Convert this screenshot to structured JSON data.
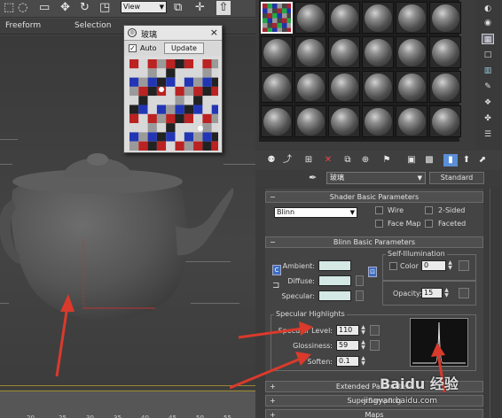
{
  "toolbar": {
    "view_dropdown": "View",
    "icons": [
      "select-region-icon",
      "move-icon",
      "rotate-icon",
      "scale-icon",
      "snap-icon",
      "render-icon"
    ]
  },
  "ribbon": {
    "tab1": "Freeform",
    "tab2": "Selection"
  },
  "viewport_ruler": {
    "ticks": [
      "20",
      "25",
      "30",
      "35",
      "40",
      "45",
      "50",
      "55",
      "60"
    ]
  },
  "preview_window": {
    "title": "玻璃",
    "close": "×",
    "auto_label": "Auto",
    "auto_checked": "✓",
    "update_label": "Update"
  },
  "material_name": "玻璃",
  "material_type": "Standard",
  "shader_basic": {
    "header": "Shader Basic Parameters",
    "shader": "Blinn",
    "wire": "Wire",
    "two_sided": "2-Sided",
    "face_map": "Face Map",
    "faceted": "Faceted"
  },
  "blinn_basic": {
    "header": "Blinn Basic Parameters",
    "self_illum_title": "Self-Illumination",
    "color_label": "Color",
    "color_value": "0",
    "ambient": "Ambient:",
    "diffuse": "Diffuse:",
    "specular": "Specular:",
    "opacity_label": "Opacity:",
    "opacity_value": "15",
    "spec_title": "Specular Highlights",
    "spec_level_label": "Specular Level:",
    "spec_level_value": "110",
    "glossiness_label": "Glossiness:",
    "glossiness_value": "59",
    "soften_label": "Soften:",
    "soften_value": "0.1"
  },
  "collapsed_rollouts": {
    "extended": "Extended Parameters",
    "supersampling": "SuperSampling",
    "maps": "Maps"
  },
  "watermark": {
    "logo": "Baidu 经验",
    "url": "jingyan.baidu.com"
  },
  "colors": {
    "swatch": "#d4e8e4",
    "active_tool": "#5a8fd8",
    "annotation_arrow": "#d93a2b"
  }
}
